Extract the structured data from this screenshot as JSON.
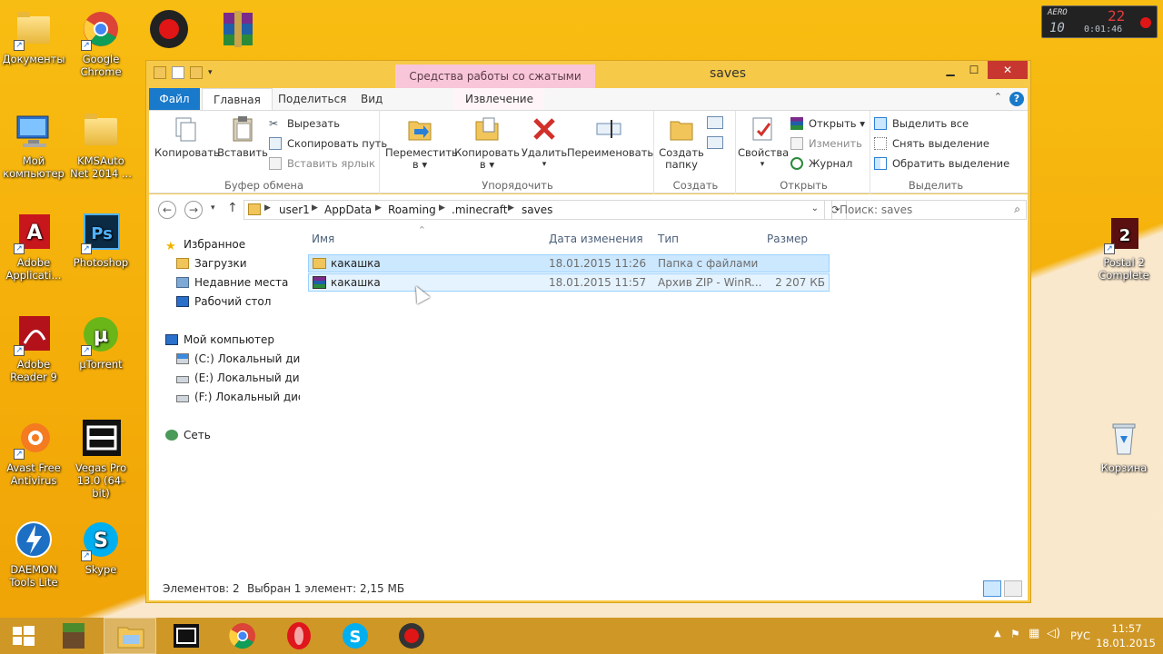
{
  "desktop": {
    "icons": [
      {
        "label": "Документы",
        "icon": "folder-icon"
      },
      {
        "label": "Google Chrome",
        "icon": "chrome-icon"
      },
      {
        "label": "Bandicam",
        "icon": "record-icon"
      },
      {
        "label": "",
        "icon": "winrar-icon"
      },
      {
        "label": "Мой компьютер",
        "icon": "computer-icon"
      },
      {
        "label": "KMSAuto Net 2014 ...",
        "icon": "folder-icon"
      },
      {
        "label": "Adobe Applicati...",
        "icon": "adobe-icon"
      },
      {
        "label": "Photoshop",
        "icon": "photoshop-icon"
      },
      {
        "label": "Adobe Reader 9",
        "icon": "acrobat-icon"
      },
      {
        "label": "µTorrent",
        "icon": "utorrent-icon"
      },
      {
        "label": "Avast Free Antivirus",
        "icon": "avast-icon"
      },
      {
        "label": "Vegas Pro 13.0 (64-bit)",
        "icon": "vegas-icon"
      },
      {
        "label": "DAEMON Tools Lite",
        "icon": "daemon-icon"
      },
      {
        "label": "Skype",
        "icon": "skype-icon"
      },
      {
        "label": "Postal 2 Complete",
        "icon": "postal-icon"
      },
      {
        "label": "Корзина",
        "icon": "recycle-bin-icon"
      }
    ],
    "clock_widget": {
      "top_left": "AERO",
      "counter": "22",
      "small": "10",
      "time": "0:01:46"
    }
  },
  "window": {
    "title": "saves",
    "context_tab_header": "Средства работы со сжатыми папками",
    "tabs": [
      "Файл",
      "Главная",
      "Поделиться",
      "Вид",
      "Извлечение"
    ],
    "ribbon": {
      "clipboard": {
        "label": "Буфер обмена",
        "copy": "Копировать",
        "paste": "Вставить",
        "cut": "Вырезать",
        "copy_path": "Скопировать путь",
        "paste_shortcut": "Вставить ярлык"
      },
      "organize": {
        "label": "Упорядочить",
        "move_to_1": "Переместить",
        "move_to_2": "в",
        "copy_to_1": "Копировать",
        "copy_to_2": "в",
        "delete": "Удалить",
        "rename": "Переименовать"
      },
      "create": {
        "label": "Создать",
        "new_folder_1": "Создать",
        "new_folder_2": "папку"
      },
      "open": {
        "label": "Открыть",
        "properties": "Свойства",
        "open": "Открыть",
        "edit": "Изменить",
        "history": "Журнал"
      },
      "select": {
        "label": "Выделить",
        "select_all": "Выделить все",
        "select_none": "Снять выделение",
        "invert": "Обратить выделение"
      }
    },
    "address": {
      "breadcrumbs": [
        "user1",
        "AppData",
        "Roaming",
        ".minecraft",
        "saves"
      ],
      "search_placeholder": "Поиск: saves"
    },
    "navpane": {
      "favorites": "Избранное",
      "downloads": "Загрузки",
      "recent": "Недавние места",
      "desktop": "Рабочий стол",
      "computer": "Мой компьютер",
      "drive_c": "(C:) Локальный дис",
      "drive_e": "(E:) Локальный дис",
      "drive_f": "(F:) Локальный дис",
      "network": "Сеть"
    },
    "columns": {
      "name": "Имя",
      "date": "Дата изменения",
      "type": "Тип",
      "size": "Размер"
    },
    "files": [
      {
        "name": "какашка",
        "date": "18.01.2015 11:26",
        "type": "Папка с файлами",
        "size": ""
      },
      {
        "name": "какашка",
        "date": "18.01.2015 11:57",
        "type": "Архив ZIP - WinR...",
        "size": "2 207 КБ"
      }
    ],
    "status": {
      "count": "Элементов: 2",
      "selected": "Выбран 1 элемент: 2,15 МБ"
    }
  },
  "taskbar": {
    "apps": [
      "start-icon",
      "minecraft-icon",
      "explorer-icon",
      "vegas-icon",
      "chrome-icon",
      "opera-icon",
      "skype-icon",
      "bandicam-icon"
    ],
    "language": "РУС",
    "time": "11:57",
    "date": "18.01.2015"
  },
  "colors": {
    "accent": "#1979ca",
    "selection": "#cce8ff",
    "desktop": "#f6b60c"
  }
}
